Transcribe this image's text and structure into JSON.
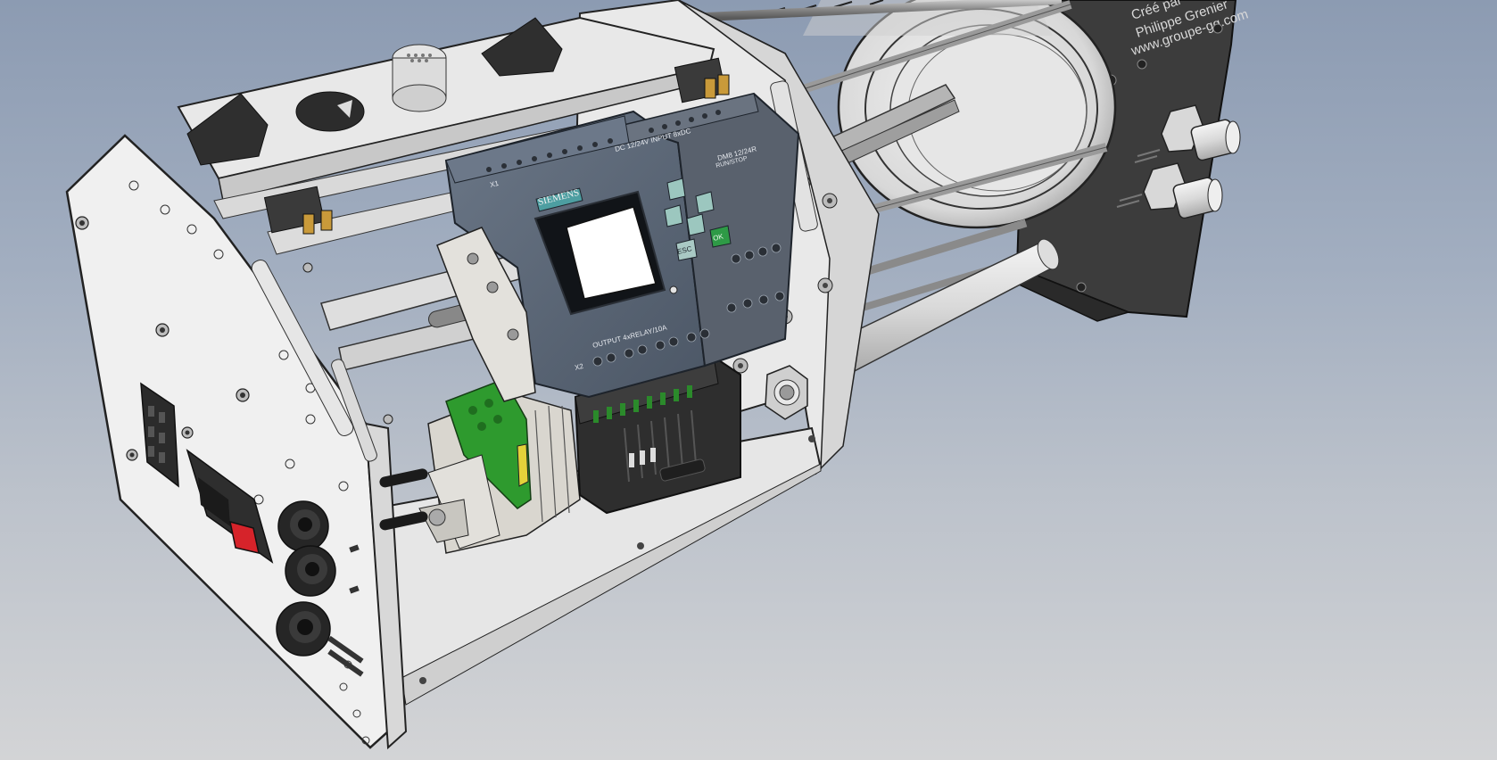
{
  "plc": {
    "brand": "SIEMENS",
    "supply_label": "DC 12/24V INPUT 8xDC",
    "model_label": "DM8 12/24R",
    "output_label": "OUTPUT 4xRELAY/10A",
    "run_stop_label": "RUN/STOP",
    "button_esc": "ESC",
    "button_ok": "OK",
    "terminal_label_1": "X1",
    "terminal_label_2": "X2"
  },
  "end_cap": {
    "credit_line_1": "Créé par",
    "credit_line_2": "Philippe Grenier",
    "credit_line_3": "www.groupe-gg.com"
  },
  "colors": {
    "background_top": "#8c9bb2",
    "background_bottom": "#d3d4d6",
    "plc_body": "#5a6675",
    "terminal_green": "#2e9a2e",
    "power_switch_red": "#d6232a"
  }
}
